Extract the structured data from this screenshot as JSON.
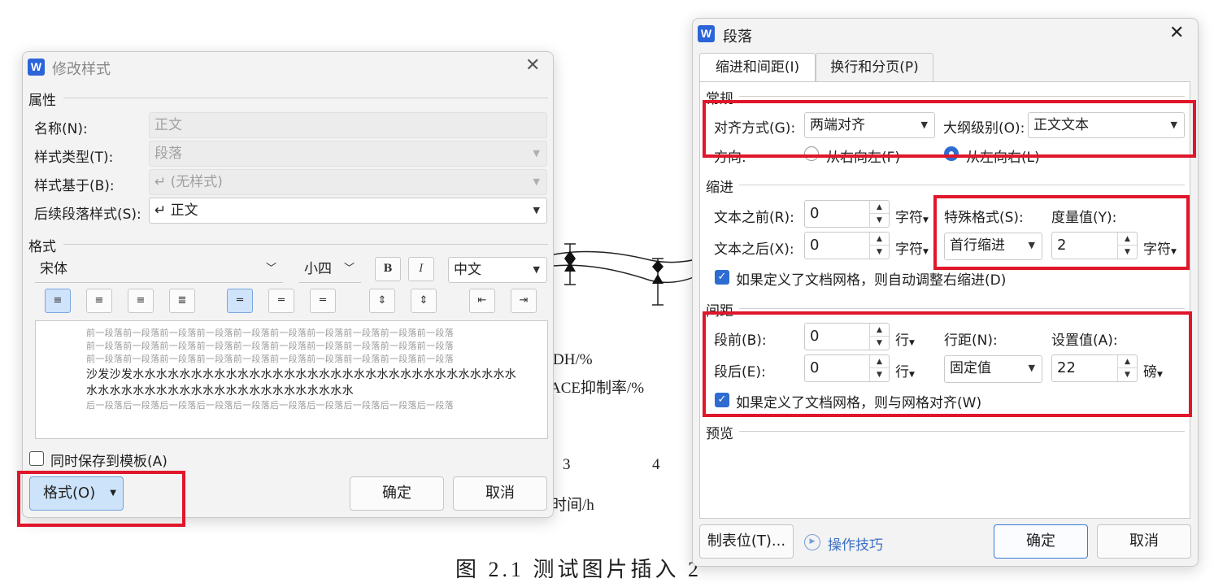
{
  "background": {
    "legend_1": "DH/%",
    "legend_2": "ACE抑制率/%",
    "tick_3": "3",
    "tick_4": "4",
    "xlabel": "时间/h",
    "caption": "图 2.1 测试图片插入 2"
  },
  "modify_style": {
    "title": "修改样式",
    "properties_heading": "属性",
    "name_label": "名称(N):",
    "name_value": "正文",
    "type_label": "样式类型(T):",
    "type_value": "段落",
    "based_label": "样式基于(B):",
    "based_value": "↵ (无样式)",
    "next_label": "后续段落样式(S):",
    "next_value": "↵ 正文",
    "format_heading": "格式",
    "font": "宋体",
    "size": "小四",
    "bold": "B",
    "italic": "I",
    "script": "中文",
    "preview_lines": [
      "前一段落前一段落前一段落前一段落前一段落前一段落前一段落前一段落前一段落前一段落",
      "前一段落前一段落前一段落前一段落前一段落前一段落前一段落前一段落前一段落前一段落",
      "前一段落前一段落前一段落前一段落前一段落前一段落前一段落前一段落前一段落前一段落"
    ],
    "preview_main_1": "沙发沙发水水水水水水水水水水水水水水水水水水水水水水水水水水水水水水水水水",
    "preview_main_2": "水水水水水水水水水水水水水水水水水水水水水水水",
    "preview_after": "后一段落后一段落后一段落后一段落后一段落后一段落后一段落后一段落后一段落后一段落",
    "save_template_label": "同时保存到模板(A)",
    "format_button": "格式(O)",
    "ok": "确定",
    "cancel": "取消"
  },
  "paragraph": {
    "title": "段落",
    "tabs": [
      "缩进和间距(I)",
      "换行和分页(P)"
    ],
    "general_heading": "常规",
    "align_label": "对齐方式(G):",
    "align_value": "两端对齐",
    "outline_label": "大纲级别(O):",
    "outline_value": "正文文本",
    "direction_label": "方向:",
    "rtl_label": "从右向左(F)",
    "ltr_label": "从左向右(L)",
    "indent_heading": "缩进",
    "before_text_label": "文本之前(R):",
    "before_text_value": "0",
    "after_text_label": "文本之后(X):",
    "after_text_value": "0",
    "unit_char": "字符",
    "special_label": "特殊格式(S):",
    "special_value": "首行缩进",
    "measure_label": "度量值(Y):",
    "measure_value": "2",
    "auto_right_indent": "如果定义了文档网格，则自动调整右缩进(D)",
    "spacing_heading": "间距",
    "before_label": "段前(B):",
    "before_value": "0",
    "after_label": "段后(E):",
    "after_value": "0",
    "unit_line": "行",
    "line_spacing_label": "行距(N):",
    "line_spacing_value": "固定值",
    "set_value_label": "设置值(A):",
    "set_value": "22",
    "unit_pound": "磅",
    "snap_grid": "如果定义了文档网格，则与网格对齐(W)",
    "preview_heading": "预览",
    "tabs_button": "制表位(T)...",
    "tips_link": "操作技巧",
    "ok": "确定",
    "cancel": "取消"
  },
  "colors": {
    "accent": "#2e6cd1",
    "highlight": "#e0162b",
    "word_logo": "#2b63d9"
  }
}
